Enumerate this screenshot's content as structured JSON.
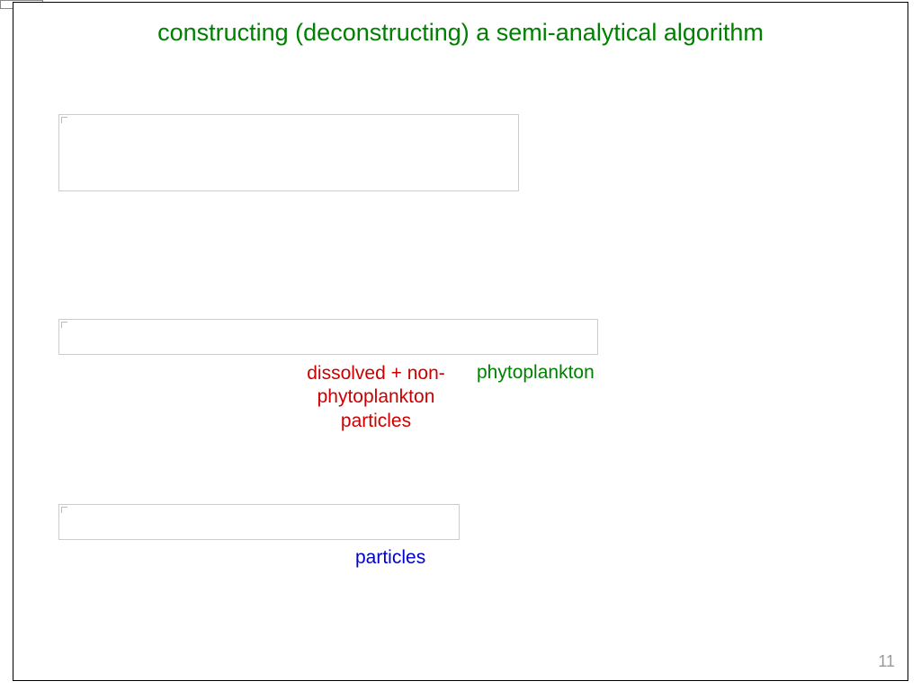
{
  "slide": {
    "title": "constructing (deconstructing) a semi-analytical algorithm",
    "labels": {
      "dissolved_nonphyto": "dissolved + non-phytoplankton particles",
      "phytoplankton": "phytoplankton",
      "particles": "particles"
    },
    "page_number": "11"
  }
}
